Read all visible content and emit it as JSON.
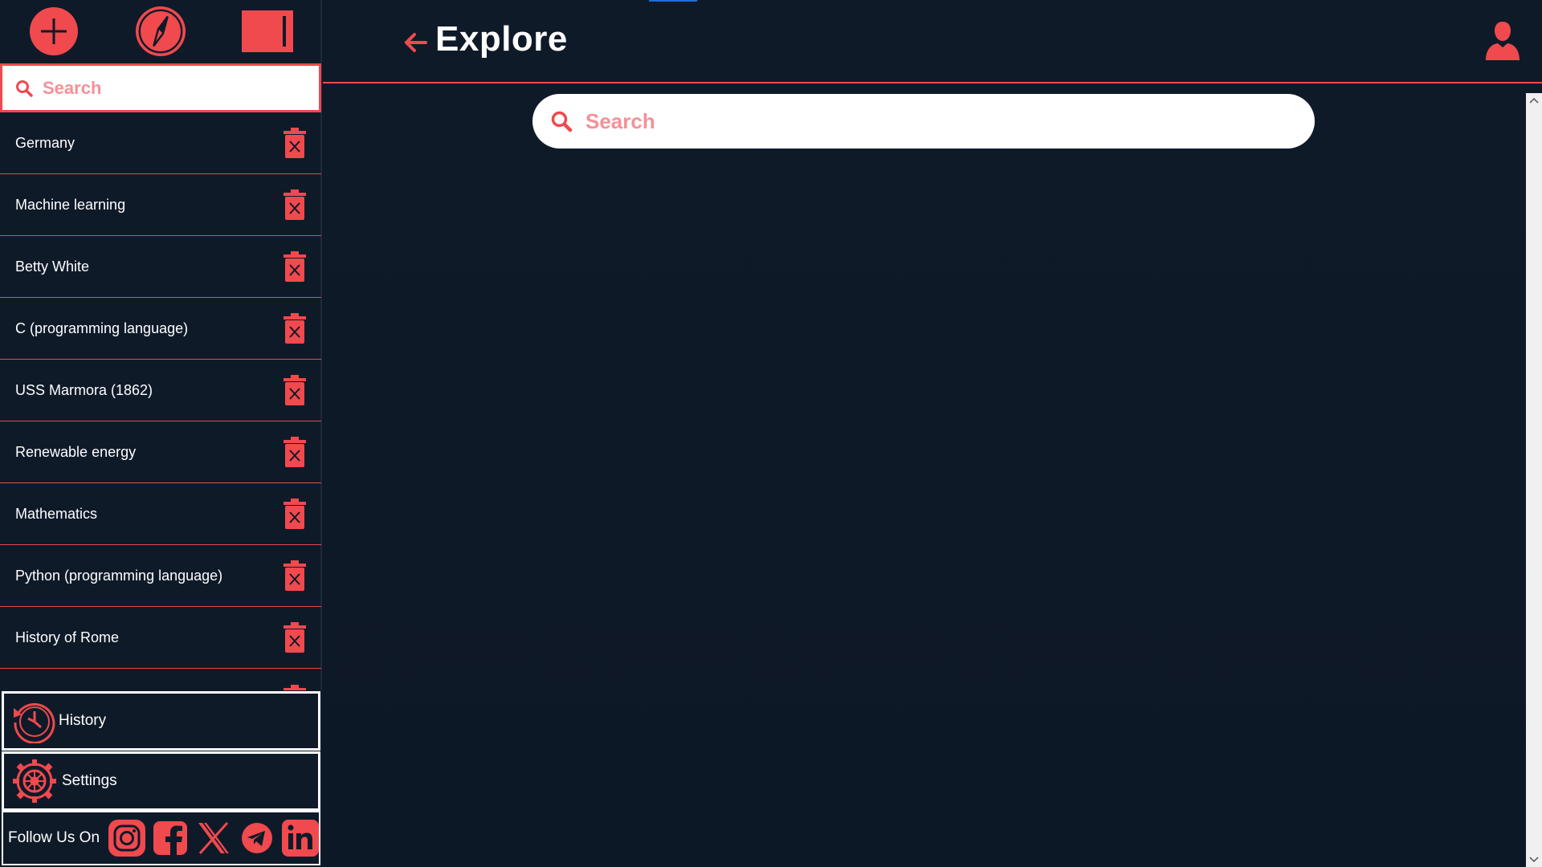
{
  "sidebar": {
    "search_placeholder": "Search",
    "items": [
      {
        "label": "Germany"
      },
      {
        "label": "Machine learning"
      },
      {
        "label": "Betty White"
      },
      {
        "label": "C (programming language)"
      },
      {
        "label": "USS Marmora (1862)"
      },
      {
        "label": "Renewable energy"
      },
      {
        "label": "Mathematics"
      },
      {
        "label": "Python (programming language)"
      },
      {
        "label": "History of Rome"
      }
    ],
    "history_label": "History",
    "settings_label": "Settings",
    "follow_label": "Follow Us On",
    "social_icons": [
      "instagram-icon",
      "facebook-icon",
      "x-icon",
      "telegram-icon",
      "linkedin-icon"
    ]
  },
  "header": {
    "title": "Explore"
  },
  "main": {
    "search_placeholder": "Search"
  },
  "colors": {
    "accent": "#f0494e",
    "background": "#0f1a29",
    "text": "#ffffff"
  }
}
